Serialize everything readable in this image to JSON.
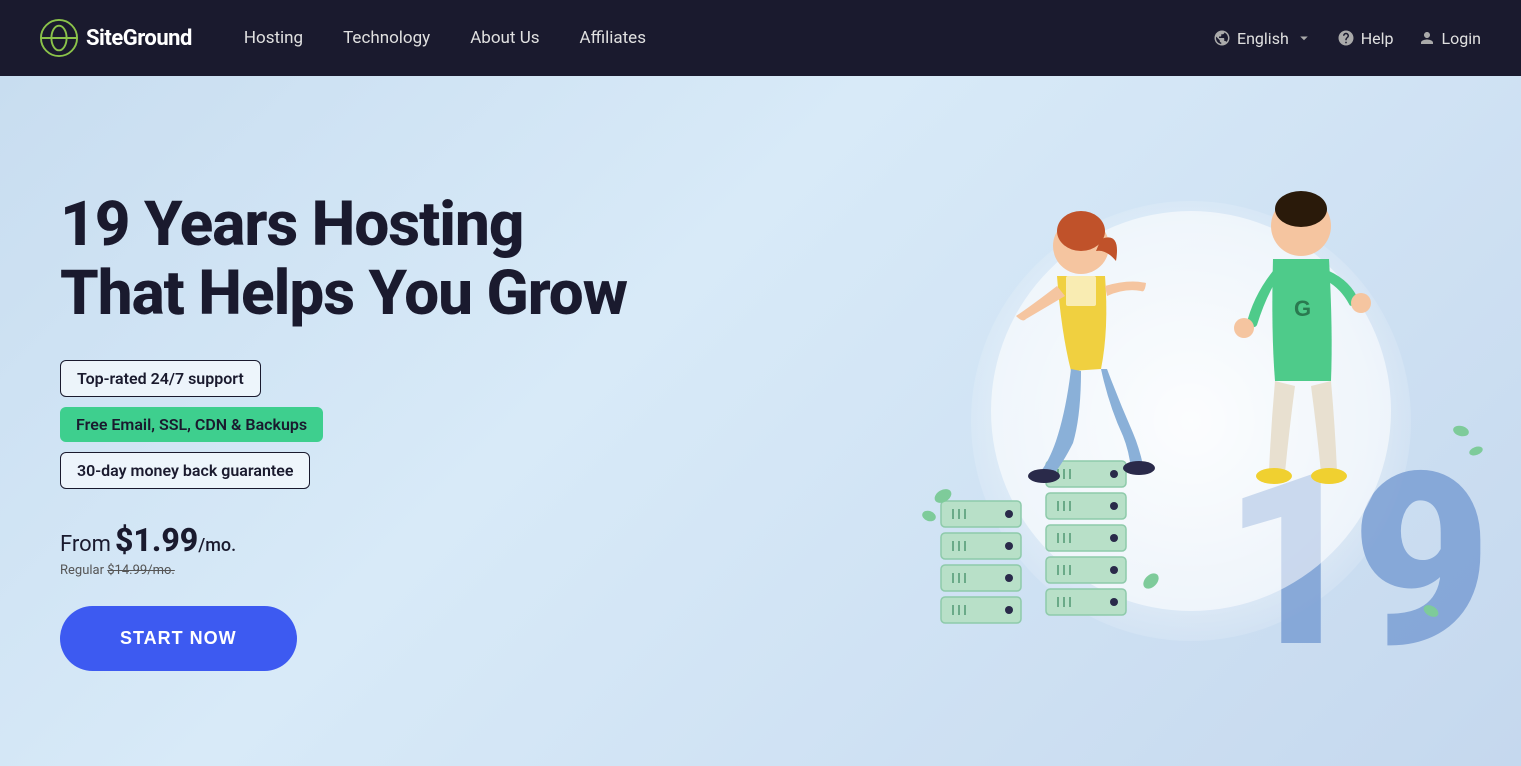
{
  "nav": {
    "logo_text": "SiteGround",
    "links": [
      {
        "label": "Hosting",
        "id": "hosting"
      },
      {
        "label": "Technology",
        "id": "technology"
      },
      {
        "label": "About Us",
        "id": "about"
      },
      {
        "label": "Affiliates",
        "id": "affiliates"
      }
    ],
    "language": "English",
    "help": "Help",
    "login": "Login"
  },
  "hero": {
    "title_line1": "19 Years Hosting",
    "title_line2": "That Helps You Grow",
    "badge1": "Top-rated 24/7 support",
    "badge2": "Free Email, SSL, CDN & Backups",
    "badge3": "30-day money back guarantee",
    "price_from": "From",
    "price_main": "$1.99",
    "price_per": "/mo.",
    "price_regular_label": "Regular",
    "price_regular": "$14.99/mo.",
    "cta_button": "START NOW",
    "number": "19"
  },
  "colors": {
    "nav_bg": "#1a1a2e",
    "hero_bg": "#c8ddf0",
    "badge_green": "#3ecf8e",
    "cta_blue": "#3d5af1",
    "number_color": "#7b9fd4",
    "server_green": "#b8e0c8"
  }
}
